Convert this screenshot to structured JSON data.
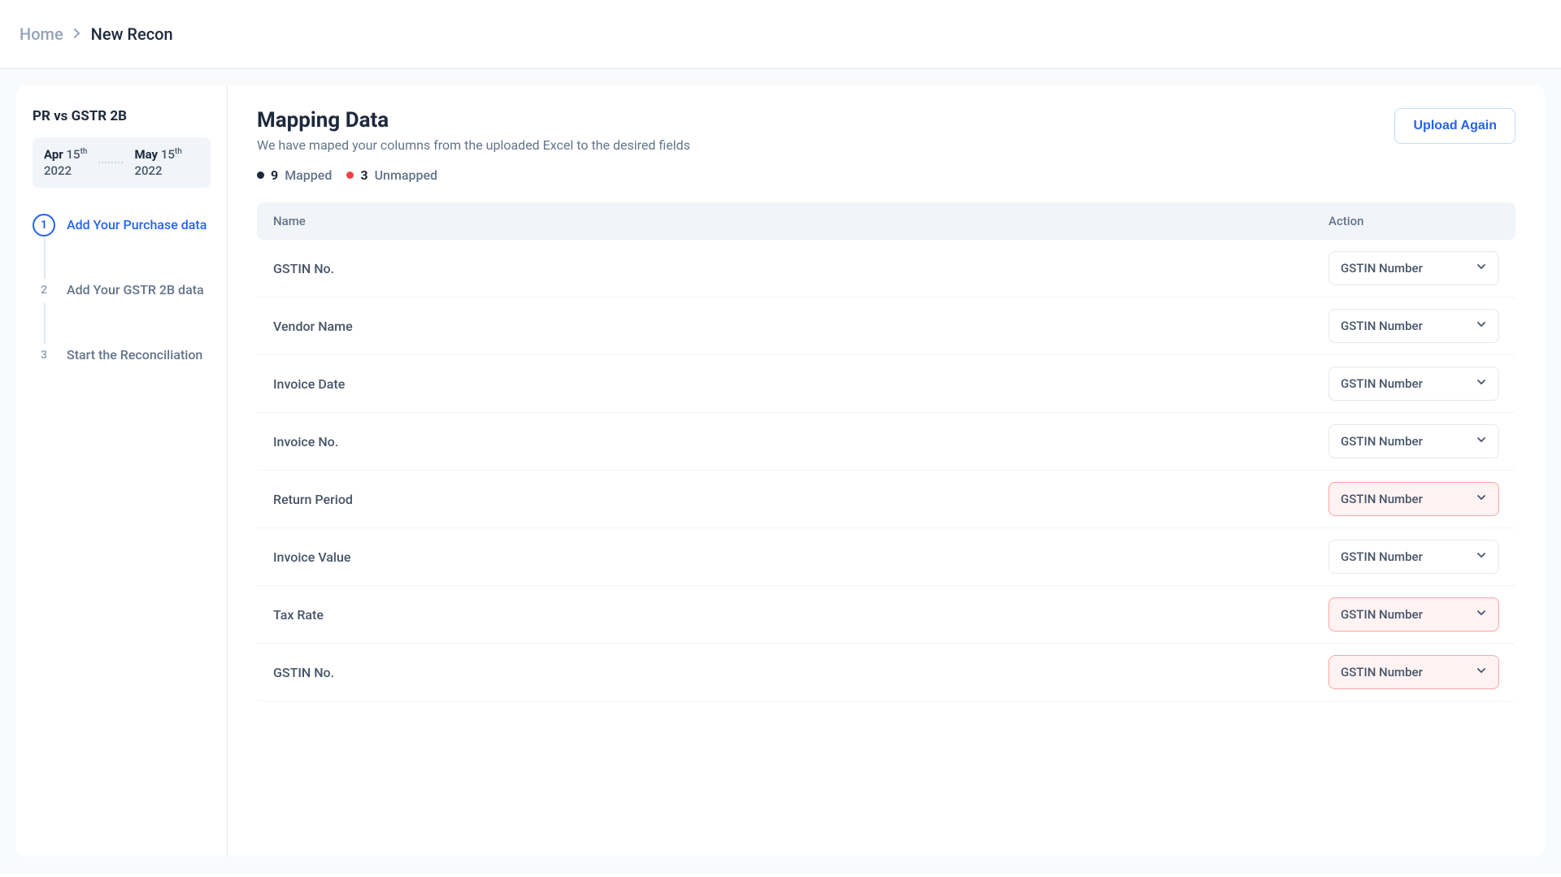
{
  "breadcrumb": {
    "home": "Home",
    "current": "New Recon"
  },
  "sidebar": {
    "title": "PR vs GSTR 2B",
    "date_from": {
      "month": "Apr",
      "day": "15",
      "suffix": "th",
      "year": "2022"
    },
    "date_to": {
      "month": "May",
      "day": "15",
      "suffix": "th",
      "year": "2022"
    },
    "steps": [
      {
        "num": "1",
        "label": "Add Your Purchase data",
        "active": true
      },
      {
        "num": "2",
        "label": "Add Your GSTR 2B data",
        "active": false
      },
      {
        "num": "3",
        "label": "Start the Reconciliation",
        "active": false
      }
    ]
  },
  "main": {
    "title": "Mapping Data",
    "subtitle": "We have maped your columns from the uploaded Excel to the desired fields",
    "upload_btn": "Upload Again",
    "status": {
      "mapped_count": "9",
      "mapped_label": "Mapped",
      "unmapped_count": "3",
      "unmapped_label": "Unmapped"
    },
    "table": {
      "header_name": "Name",
      "header_action": "Action",
      "select_value": "GSTIN Number",
      "rows": [
        {
          "name": "GSTIN No.",
          "error": false
        },
        {
          "name": "Vendor Name",
          "error": false
        },
        {
          "name": "Invoice Date",
          "error": false
        },
        {
          "name": "Invoice No.",
          "error": false
        },
        {
          "name": "Return Period",
          "error": true
        },
        {
          "name": "Invoice Value",
          "error": false
        },
        {
          "name": "Tax Rate",
          "error": true
        },
        {
          "name": "GSTIN No.",
          "error": true
        }
      ]
    }
  }
}
